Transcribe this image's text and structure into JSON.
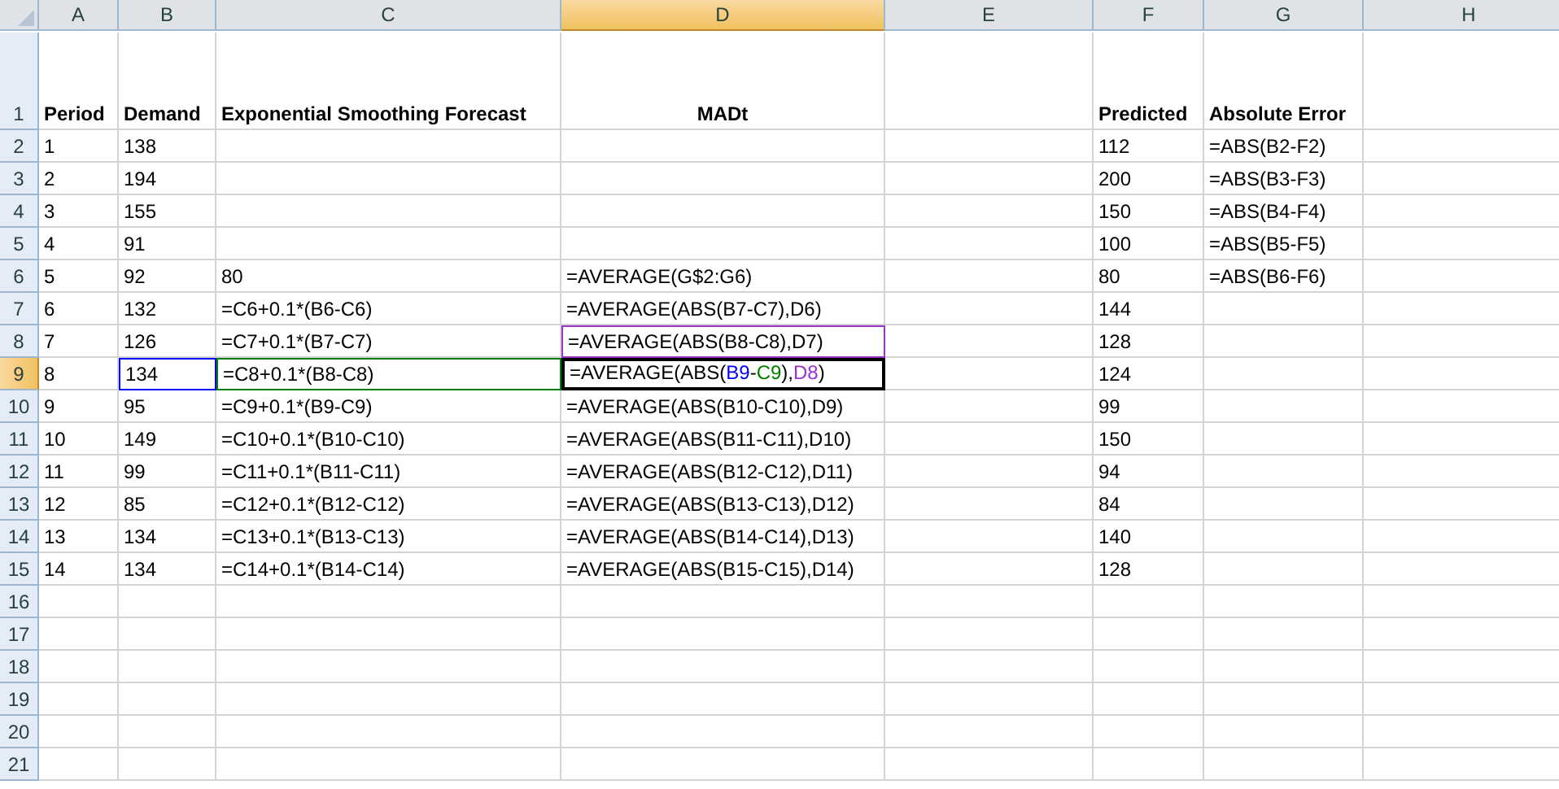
{
  "columns": [
    {
      "label": "A",
      "selected": false
    },
    {
      "label": "B",
      "selected": false
    },
    {
      "label": "C",
      "selected": false
    },
    {
      "label": "D",
      "selected": true
    },
    {
      "label": "E",
      "selected": false
    },
    {
      "label": "F",
      "selected": false
    },
    {
      "label": "G",
      "selected": false
    },
    {
      "label": "H",
      "selected": false
    }
  ],
  "rows": [
    {
      "label": "1",
      "selected": false,
      "header": true,
      "cells": [
        "Period",
        "Demand",
        "Exponential Smoothing Forecast",
        {
          "text": "MADt",
          "centered": true
        },
        null,
        "Predicted",
        "Absolute Error"
      ]
    },
    {
      "label": "2",
      "selected": false,
      "cells": [
        "1",
        "138",
        null,
        null,
        null,
        "112",
        "=ABS(B2-F2)"
      ]
    },
    {
      "label": "3",
      "selected": false,
      "cells": [
        "2",
        "194",
        null,
        null,
        null,
        "200",
        "=ABS(B3-F3)"
      ]
    },
    {
      "label": "4",
      "selected": false,
      "cells": [
        "3",
        "155",
        null,
        null,
        null,
        "150",
        "=ABS(B4-F4)"
      ]
    },
    {
      "label": "5",
      "selected": false,
      "cells": [
        "4",
        "91",
        null,
        null,
        null,
        "100",
        "=ABS(B5-F5)"
      ]
    },
    {
      "label": "6",
      "selected": false,
      "cells": [
        "5",
        "92",
        "80",
        "=AVERAGE(G$2:G6)",
        null,
        "80",
        "=ABS(B6-F6)"
      ]
    },
    {
      "label": "7",
      "selected": false,
      "cells": [
        "6",
        "132",
        "=C6+0.1*(B6-C6)",
        "=AVERAGE(ABS(B7-C7),D6)",
        null,
        "144"
      ]
    },
    {
      "label": "8",
      "selected": false,
      "cells": [
        "7",
        "126",
        "=C7+0.1*(B7-C7)",
        {
          "text": "=AVERAGE(ABS(B8-C8),D7)",
          "color": "#9933cc"
        },
        null,
        "128"
      ]
    },
    {
      "label": "9",
      "selected": true,
      "cells": [
        "8",
        {
          "text": "134",
          "color": "#0000ff"
        },
        {
          "text": "=C8+0.1*(B8-C8)",
          "color": "#008000"
        },
        {
          "active": true,
          "segments": [
            {
              "text": "=AVERAGE(ABS("
            },
            {
              "text": "B9",
              "color": "#0000ff"
            },
            {
              "text": "-"
            },
            {
              "text": "C9",
              "color": "#008000"
            },
            {
              "text": "),"
            },
            {
              "text": "D8",
              "color": "#9933cc"
            },
            {
              "text": ")"
            }
          ]
        },
        null,
        "124"
      ]
    },
    {
      "label": "10",
      "selected": false,
      "cells": [
        "9",
        "95",
        "=C9+0.1*(B9-C9)",
        "=AVERAGE(ABS(B10-C10),D9)",
        null,
        "99"
      ]
    },
    {
      "label": "11",
      "selected": false,
      "cells": [
        "10",
        "149",
        "=C10+0.1*(B10-C10)",
        "=AVERAGE(ABS(B11-C11),D10)",
        null,
        "150"
      ]
    },
    {
      "label": "12",
      "selected": false,
      "cells": [
        "11",
        "99",
        "=C11+0.1*(B11-C11)",
        "=AVERAGE(ABS(B12-C12),D11)",
        null,
        "94"
      ]
    },
    {
      "label": "13",
      "selected": false,
      "cells": [
        "12",
        "85",
        "=C12+0.1*(B12-C12)",
        "=AVERAGE(ABS(B13-C13),D12)",
        null,
        "84"
      ]
    },
    {
      "label": "14",
      "selected": false,
      "cells": [
        "13",
        "134",
        "=C13+0.1*(B13-C13)",
        "=AVERAGE(ABS(B14-C14),D13)",
        null,
        "140"
      ]
    },
    {
      "label": "15",
      "selected": false,
      "cells": [
        "14",
        "134",
        "=C14+0.1*(B14-C14)",
        "=AVERAGE(ABS(B15-C15),D14)",
        null,
        "128"
      ]
    },
    {
      "label": "16",
      "selected": false
    },
    {
      "label": "17",
      "selected": false
    },
    {
      "label": "18",
      "selected": false
    },
    {
      "label": "19",
      "selected": false
    },
    {
      "label": "20",
      "selected": false
    },
    {
      "label": "21",
      "selected": false
    }
  ]
}
